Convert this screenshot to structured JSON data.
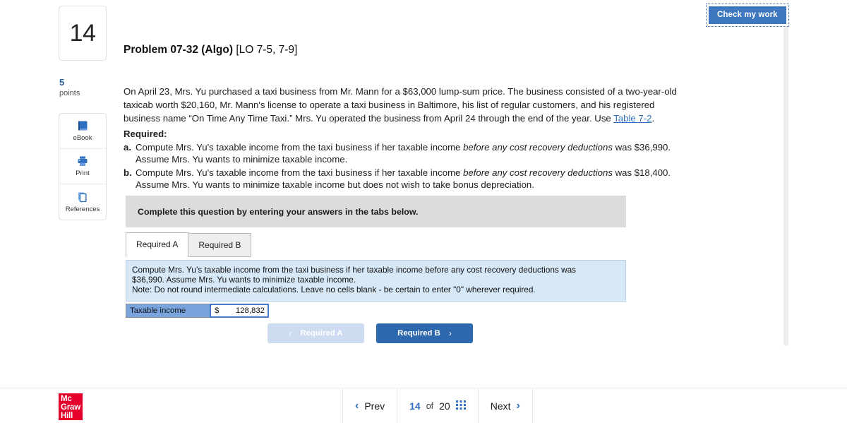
{
  "header": {
    "check_my_work_label": "Check my work"
  },
  "rail": {
    "question_number": "14",
    "points_value": "5",
    "points_label": "points",
    "tools": [
      {
        "icon": "ebook-icon",
        "label": "eBook"
      },
      {
        "icon": "print-icon",
        "label": "Print"
      },
      {
        "icon": "references-icon",
        "label": "References"
      }
    ]
  },
  "problem": {
    "title_bold": "Problem 07-32 (Algo)",
    "title_lo": " [LO 7-5, 7-9]",
    "body_1": "On April 23, Mrs. Yu purchased a taxi business from Mr. Mann for a $63,000 lump-sum price. The business consisted of a two-year-old taxicab worth $20,160, Mr. Mann's license to operate a taxi business in Baltimore, his list of regular customers, and his registered business name “On Time Any Time Taxi.” Mrs. Yu operated the business from April 24 through the end of the year. Use ",
    "body_link": "Table 7-2",
    "body_2": ".",
    "required_heading": "Required:",
    "requirements": [
      {
        "marker": "a.",
        "text_1": "Compute Mrs. Yu's taxable income from the taxi business if her taxable income ",
        "text_italic": "before any cost recovery deductions",
        "text_2": " was $36,990. Assume Mrs. Yu wants to minimize taxable income."
      },
      {
        "marker": "b.",
        "text_1": "Compute Mrs. Yu's taxable income from the taxi business if her taxable income ",
        "text_italic": "before any cost recovery deductions",
        "text_2": " was $18,400. Assume Mrs. Yu wants to minimize taxable income but does not wish to take bonus depreciation."
      }
    ]
  },
  "instruction_bar": {
    "text": "Complete this question by entering your answers in the tabs below."
  },
  "tabs": [
    {
      "label": "Required A",
      "active": true
    },
    {
      "label": "Required B",
      "active": false
    }
  ],
  "blue_panel": {
    "line_1": "Compute Mrs. Yu’s taxable income from the taxi business if her taxable income before any cost recovery deductions was",
    "line_2": "$36,990. Assume Mrs. Yu wants to minimize taxable income.",
    "note": "Note: Do not round intermediate calculations. Leave no cells blank - be certain to enter \"0\" wherever required."
  },
  "answer": {
    "row_label": "Taxable income",
    "currency": "$",
    "value": "128,832"
  },
  "req_nav": {
    "prev_label": "Required A",
    "next_label": "Required B",
    "prev_chevron": "‹",
    "next_chevron": "›"
  },
  "footer": {
    "logo_line_1": "Mc",
    "logo_line_2": "Graw",
    "logo_line_3": "Hill",
    "prev_label": "Prev",
    "prev_chevron": "‹",
    "page_number": "14",
    "page_of": "of",
    "page_total": "20",
    "next_label": "Next",
    "next_chevron": "›"
  },
  "colors": {
    "accent_blue": "#2f6fbf",
    "button_blue": "#3d77bf",
    "panel_blue": "#d7e8f7",
    "label_blue": "#7aa4dd",
    "note_red": "#cc1c1c",
    "brand_red": "#e4002b",
    "gray_bar": "#dcdcdc"
  }
}
